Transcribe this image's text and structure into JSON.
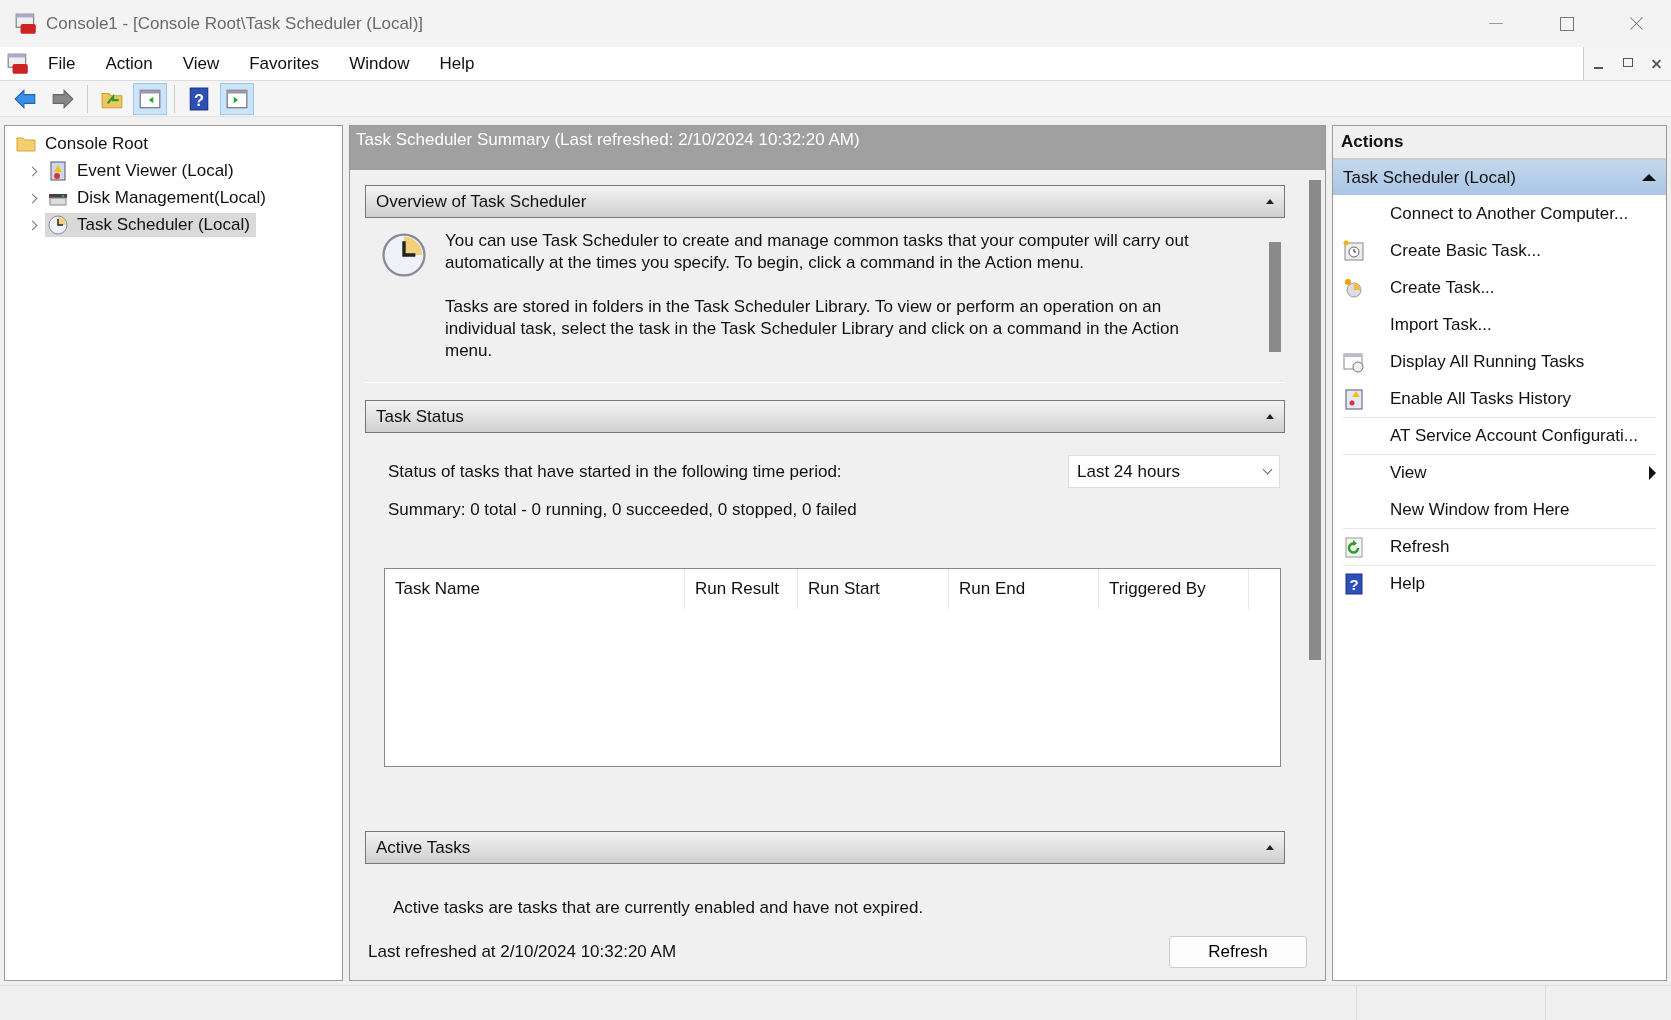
{
  "window": {
    "title": "Console1 - [Console Root\\Task Scheduler (Local)]"
  },
  "menu": [
    "File",
    "Action",
    "View",
    "Favorites",
    "Window",
    "Help"
  ],
  "toolbar": [
    {
      "kind": "back",
      "pressed": false
    },
    {
      "kind": "forward",
      "pressed": false
    },
    {
      "kind": "up",
      "pressed": false
    },
    {
      "kind": "tree-pane",
      "pressed": true
    },
    {
      "kind": "help",
      "glyph": "?",
      "pressed": false
    },
    {
      "kind": "action-pane",
      "pressed": true
    }
  ],
  "tree": [
    {
      "label": "Console Root",
      "kind": "folder",
      "children": [
        {
          "label": "Event Viewer (Local)",
          "kind": "log",
          "expanded": false,
          "selected": false
        },
        {
          "label": "Disk Management(Local)",
          "kind": "disk",
          "expanded": false,
          "selected": false
        },
        {
          "label": "Task Scheduler (Local)",
          "kind": "clock",
          "expanded": false,
          "selected": true
        }
      ]
    }
  ],
  "summary": {
    "header": "Task Scheduler Summary (Last refreshed: 2/10/2024 10:32:20 AM)",
    "overview": {
      "title": "Overview of Task Scheduler",
      "expanded": true,
      "paragraphs": [
        "You can use Task Scheduler to create and manage common tasks that your computer will carry out automatically at the times you specify. To begin, click a command in the Action menu.",
        "Tasks are stored in folders in the Task Scheduler Library. To view or perform an operation on an individual task, select the task in the Task Scheduler Library and click on a command in the Action menu."
      ]
    },
    "task_status": {
      "title": "Task Status",
      "expanded": true,
      "period_label": "Status of tasks that have started in the following time period:",
      "period": "Last 24 hours",
      "summary": "Summary: 0 total - 0 running, 0 succeeded, 0 stopped, 0 failed",
      "columns": [
        "Task Name",
        "Run Result",
        "Run Start",
        "Run End",
        "Triggered By"
      ]
    },
    "active_tasks": {
      "title": "Active Tasks",
      "expanded": true,
      "text": "Active tasks are tasks that are currently enabled and have not expired."
    },
    "last_refreshed": "Last refreshed at 2/10/2024 10:32:20 AM",
    "refresh_button": "Refresh"
  },
  "actions": {
    "title": "Actions",
    "group": "Task Scheduler (Local)",
    "expanded": true,
    "items": [
      {
        "label": "Connect to Another Computer...",
        "kind": "plain",
        "submenu": false,
        "separator_after": false
      },
      {
        "label": "Create Basic Task...",
        "kind": "basic-task",
        "submenu": false,
        "separator_after": false
      },
      {
        "label": "Create Task...",
        "kind": "task",
        "submenu": false,
        "separator_after": false
      },
      {
        "label": "Import Task...",
        "kind": "plain",
        "submenu": false,
        "separator_after": false
      },
      {
        "label": "Display All Running Tasks",
        "kind": "running",
        "submenu": false,
        "separator_after": false
      },
      {
        "label": "Enable All Tasks History",
        "kind": "history",
        "submenu": false,
        "separator_after": true
      },
      {
        "label": "AT Service Account Configurati...",
        "kind": "plain",
        "submenu": false,
        "separator_after": true
      },
      {
        "label": "View",
        "kind": "plain",
        "submenu": true,
        "separator_after": false
      },
      {
        "label": "New Window from Here",
        "kind": "plain",
        "submenu": false,
        "separator_after": true
      },
      {
        "label": "Refresh",
        "kind": "refresh",
        "submenu": false,
        "separator_after": true
      },
      {
        "label": "Help",
        "kind": "help",
        "glyph": "?",
        "submenu": false,
        "separator_after": false
      }
    ]
  }
}
